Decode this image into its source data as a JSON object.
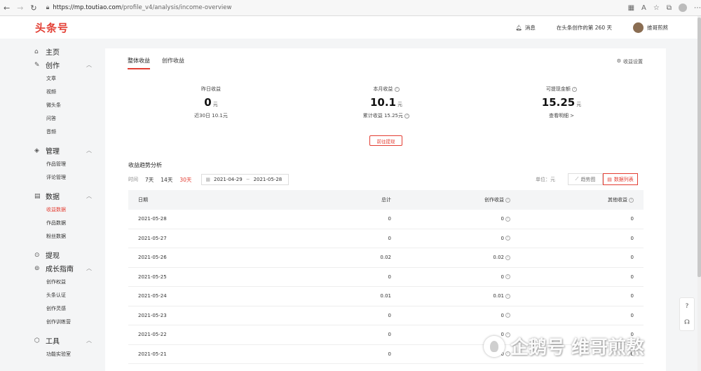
{
  "browser": {
    "url_host": "https://mp.toutiao.com",
    "url_path": "/profile_v4/analysis/income-overview"
  },
  "header": {
    "logo": "头条号",
    "messages_label": "消息",
    "days_text": "在头条创作的第 260 天",
    "username": "维哥煎熬"
  },
  "sidebar": {
    "groups": [
      {
        "label": "主页",
        "icon": "home-icon",
        "items": []
      },
      {
        "label": "创作",
        "icon": "pen-icon",
        "items": [
          "文章",
          "视频",
          "微头条",
          "问答",
          "音频"
        ]
      },
      {
        "label": "管理",
        "icon": "layers-icon",
        "items": [
          "作品管理",
          "评论管理"
        ]
      },
      {
        "label": "数据",
        "icon": "database-icon",
        "items": [
          "收益数据",
          "作品数据",
          "粉丝数据"
        ]
      },
      {
        "label": "提现",
        "icon": "withdraw-icon",
        "items": []
      },
      {
        "label": "成长指南",
        "icon": "growth-icon",
        "items": [
          "创作权益",
          "头条认证",
          "创作灵感",
          "创作训练营"
        ]
      },
      {
        "label": "工具",
        "icon": "tools-icon",
        "items": [
          "功能实验室"
        ]
      }
    ],
    "active_item": "收益数据"
  },
  "tabs": [
    "整体收益",
    "创作收益"
  ],
  "settings_label": "收益设置",
  "stats": {
    "yesterday": {
      "label": "昨日收益",
      "value": "0",
      "unit": "元",
      "sub": "近30日 10.1元"
    },
    "month": {
      "label": "本月收益",
      "value": "10.1",
      "unit": "元",
      "sub": "累计收益 15.25元"
    },
    "withdrawable": {
      "label": "可提现金额",
      "value": "15.25",
      "unit": "元",
      "sub": "查看明细 >"
    }
  },
  "withdraw_button": "前往提现",
  "trend": {
    "title": "收益趋势分析",
    "time_label": "时间",
    "ranges": [
      "7天",
      "14天",
      "30天"
    ],
    "active_range": "30天",
    "date_start": "2021-04-29",
    "date_sep": "~",
    "date_end": "2021-05-28",
    "unit_label": "单位：元",
    "view_chart": "趋势图",
    "view_table": "数据列表"
  },
  "table": {
    "headers": [
      "日期",
      "总计",
      "创作收益",
      "其他收益"
    ],
    "rows": [
      [
        "2021-05-28",
        "0",
        "0",
        "0"
      ],
      [
        "2021-05-27",
        "0",
        "0",
        "0"
      ],
      [
        "2021-05-26",
        "0.02",
        "0.02",
        "0"
      ],
      [
        "2021-05-25",
        "0",
        "0",
        "0"
      ],
      [
        "2021-05-24",
        "0.01",
        "0.01",
        "0"
      ],
      [
        "2021-05-23",
        "0",
        "0",
        "0"
      ],
      [
        "2021-05-22",
        "0",
        "0",
        "0"
      ],
      [
        "2021-05-21",
        "0",
        "0",
        "0"
      ]
    ]
  },
  "watermark": "企鹅号 维哥煎熬"
}
